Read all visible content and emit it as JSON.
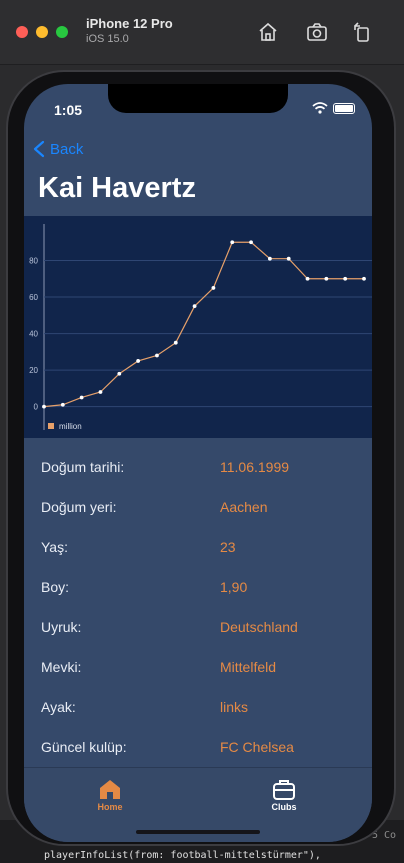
{
  "simulator": {
    "device": "iPhone 12 Pro",
    "os": "iOS 15.0",
    "code_line_1": "5 Co",
    "code_line_2": "playerInfoList(from: football-mittelstürmer\"),"
  },
  "status": {
    "time": "1:05"
  },
  "nav": {
    "back_label": "Back",
    "title": "Kai Havertz"
  },
  "chart_data": {
    "type": "line",
    "title": "",
    "xlabel": "",
    "ylabel": "",
    "legend": "million",
    "legend_position": "bottom-left",
    "ylim": [
      -15,
      100
    ],
    "yticks": [
      0,
      20,
      40,
      60,
      80
    ],
    "grid": true,
    "line_color": "#e6a06a",
    "point_color": "#ffffff",
    "x": [
      0,
      1,
      2,
      3,
      4,
      5,
      6,
      7,
      8,
      9,
      10,
      11,
      12,
      13,
      14,
      15,
      16,
      17
    ],
    "values": [
      0,
      1,
      5,
      8,
      18,
      25,
      28,
      35,
      55,
      65,
      90,
      90,
      81,
      81,
      70,
      70,
      70,
      70
    ]
  },
  "info": {
    "rows": [
      {
        "label": "Doğum tarihi:",
        "value": "11.06.1999"
      },
      {
        "label": "Doğum yeri:",
        "value": "Aachen"
      },
      {
        "label": "Yaş:",
        "value": "23"
      },
      {
        "label": "Boy:",
        "value": "1,90"
      },
      {
        "label": "Uyruk:",
        "value": "Deutschland"
      },
      {
        "label": "Mevki:",
        "value": "Mittelfeld"
      },
      {
        "label": "Ayak:",
        "value": "links"
      },
      {
        "label": "Güncel kulüp:",
        "value": "FC Chelsea"
      }
    ]
  },
  "tabs": {
    "home_label": "Home",
    "clubs_label": "Clubs",
    "active": "Home"
  },
  "colors": {
    "accent": "#e58a45",
    "link": "#1a86ff",
    "background": "#35496a",
    "chart_bg": "#11254b"
  }
}
